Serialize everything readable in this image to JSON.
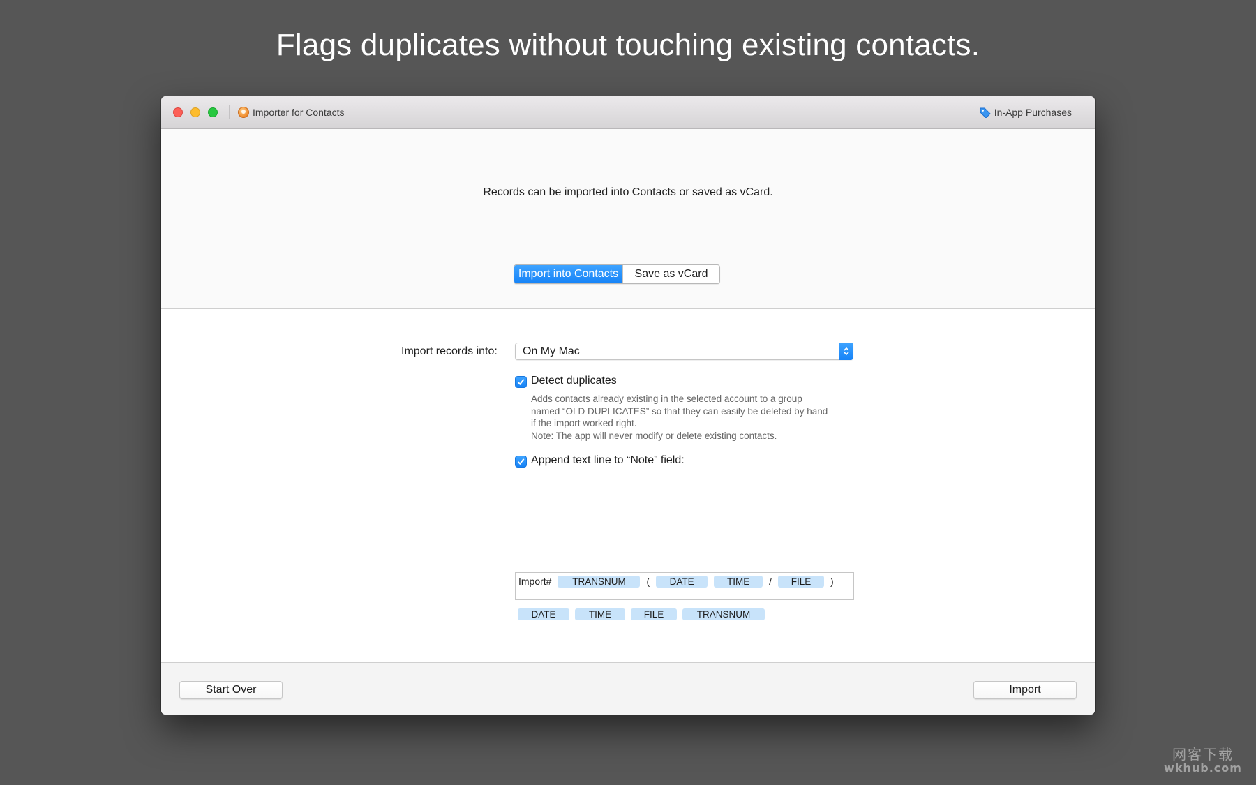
{
  "headline": "Flags duplicates without touching existing contacts.",
  "window": {
    "title": "Importer for Contacts",
    "in_app_purchases_label": "In-App Purchases"
  },
  "top_pane": {
    "intro": "Records can be imported into Contacts or saved as vCard.",
    "segments": [
      {
        "label": "Import into Contacts",
        "selected": true
      },
      {
        "label": "Save as vCard",
        "selected": false
      }
    ]
  },
  "form": {
    "import_into_label": "Import records into:",
    "import_into_value": "On My Mac",
    "detect_duplicates": {
      "label": "Detect duplicates",
      "checked": true,
      "help_lines": [
        "Adds contacts already existing in the selected account to a group",
        "named “OLD DUPLICATES” so that they can easily be deleted by hand",
        "if the import worked right.",
        "Note: The app will never modify or delete existing contacts."
      ]
    },
    "append_note": {
      "label": "Append text line to “Note” field:",
      "checked": true,
      "field": {
        "prefix": "Import#",
        "open_paren": "(",
        "slash": "/",
        "close_paren": ")",
        "tokens": [
          "TRANSNUM",
          "DATE",
          "TIME",
          "FILE"
        ]
      },
      "palette": [
        "DATE",
        "TIME",
        "FILE",
        "TRANSNUM"
      ]
    }
  },
  "buttons": {
    "start_over": "Start Over",
    "import": "Import"
  },
  "watermark": {
    "cn": "网客下载",
    "url": "wkhub.com"
  },
  "colors": {
    "accent": "#1683f7",
    "token_bg": "#c8e3fa",
    "desktop": "#565656"
  }
}
